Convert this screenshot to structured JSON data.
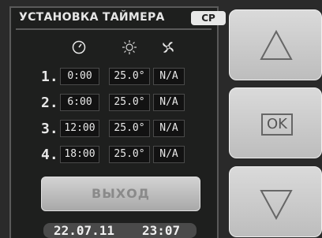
{
  "header": {
    "title": "УСТАНОВКА ТАЙМЕРА",
    "mode_badge": "CP"
  },
  "columns": {
    "icons": [
      "clock-icon",
      "sun-icon",
      "fan-icon"
    ]
  },
  "rows": [
    {
      "num": "1.",
      "time": "0:00",
      "temp": "25.0°",
      "fan": "N/A"
    },
    {
      "num": "2.",
      "time": "6:00",
      "temp": "25.0°",
      "fan": "N/A"
    },
    {
      "num": "3.",
      "time": "12:00",
      "temp": "25.0°",
      "fan": "N/A"
    },
    {
      "num": "4.",
      "time": "18:00",
      "temp": "25.0°",
      "fan": "N/A"
    }
  ],
  "exit_label": "ВЫХОД",
  "status": {
    "date": "22.07.11",
    "time": "23:07"
  },
  "side_buttons": {
    "ok_label": "OK"
  }
}
